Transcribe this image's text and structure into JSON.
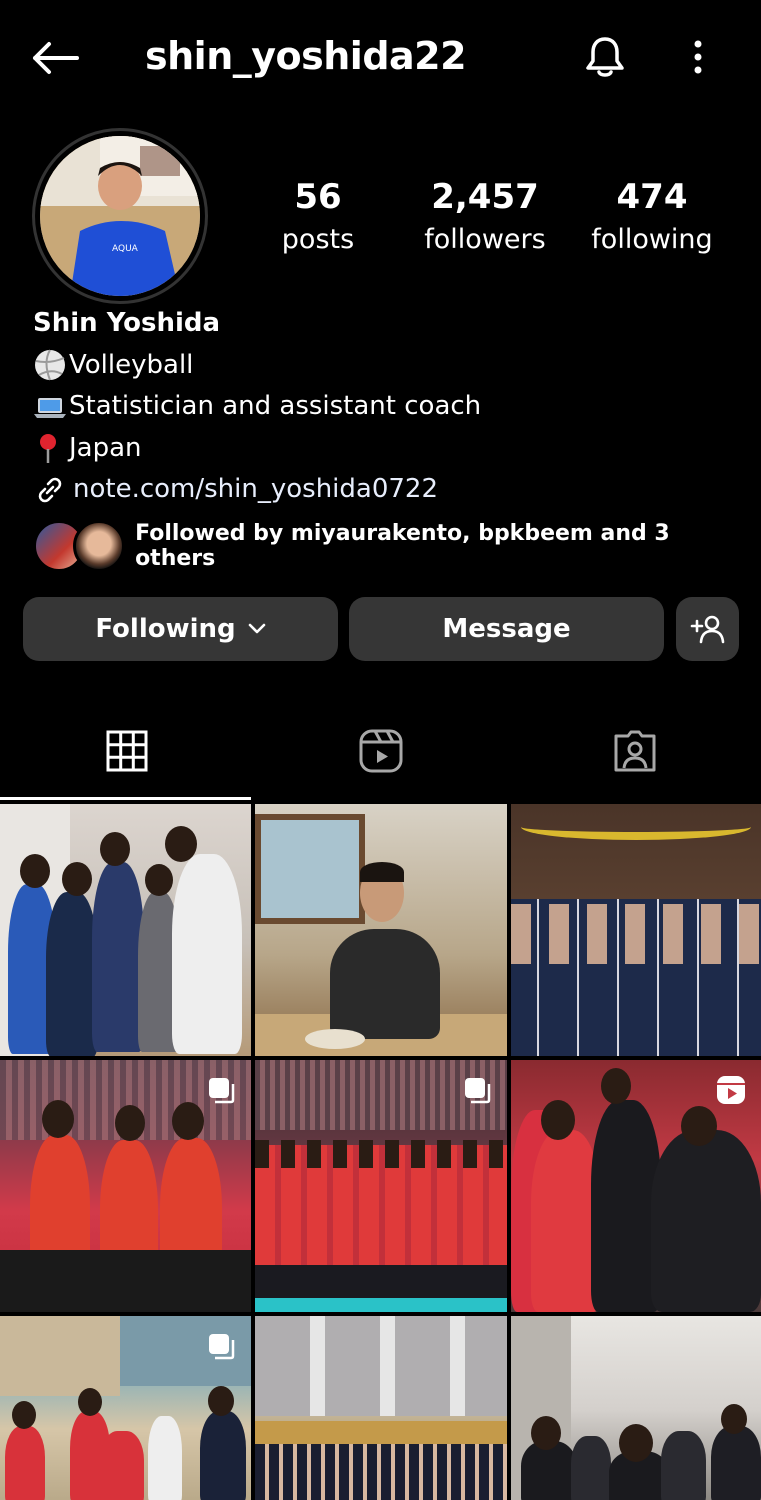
{
  "header": {
    "username": "shin_yoshida22"
  },
  "stats": {
    "posts_count": "56",
    "posts_label": "posts",
    "followers_count": "2,457",
    "followers_label": "followers",
    "following_count": "474",
    "following_label": "following"
  },
  "bio": {
    "name": "Shin Yoshida",
    "line1": "Volleyball",
    "line2": "Statistician and assistant coach",
    "line3": "Japan",
    "link": "note.com/shin_yoshida0722"
  },
  "followed_by": "Followed by miyaurakento, bpkbeem and 3 others",
  "buttons": {
    "following": "Following",
    "message": "Message"
  },
  "tabs": [
    "posts-grid",
    "reels",
    "tagged"
  ],
  "icons": {
    "back": "arrow-left-icon",
    "bell": "bell-icon",
    "more": "more-vertical-icon",
    "chevron": "chevron-down-icon",
    "add_user": "add-user-icon",
    "link": "link-icon"
  },
  "colors": {
    "background": "#000000",
    "button_bg": "#363636",
    "text": "#ffffff"
  }
}
